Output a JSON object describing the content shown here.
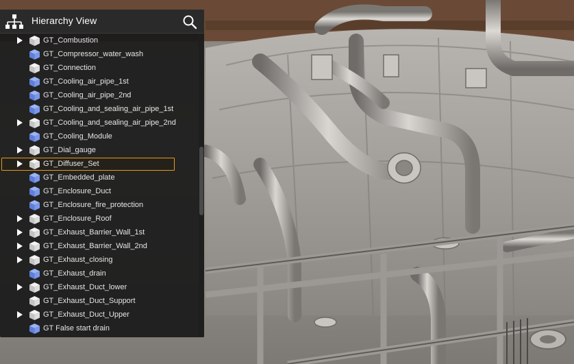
{
  "panel": {
    "title": "Hierarchy View",
    "header_icon": "hierarchy-icon",
    "search_icon": "search-icon"
  },
  "colors": {
    "selection": "#e59a19",
    "panel_bg": "#1a1a1a",
    "cube_blue": "#6f8fe6",
    "cube_gray": "#d6d6d6"
  },
  "items": [
    {
      "label": "GT_Combustion",
      "expandable": true,
      "cube": "gray",
      "selected": false
    },
    {
      "label": "GT_Compressor_water_wash",
      "expandable": false,
      "cube": "blue",
      "selected": false
    },
    {
      "label": "GT_Connection",
      "expandable": false,
      "cube": "gray",
      "selected": false
    },
    {
      "label": "GT_Cooling_air_pipe_1st",
      "expandable": false,
      "cube": "blue",
      "selected": false
    },
    {
      "label": "GT_Cooling_air_pipe_2nd",
      "expandable": false,
      "cube": "blue",
      "selected": false
    },
    {
      "label": "GT_Cooling_and_sealing_air_pipe_1st",
      "expandable": false,
      "cube": "blue",
      "selected": false
    },
    {
      "label": "GT_Cooling_and_sealing_air_pipe_2nd",
      "expandable": true,
      "cube": "gray",
      "selected": false
    },
    {
      "label": "GT_Cooling_Module",
      "expandable": false,
      "cube": "blue",
      "selected": false
    },
    {
      "label": "GT_Dial_gauge",
      "expandable": true,
      "cube": "gray",
      "selected": false
    },
    {
      "label": "GT_Diffuser_Set",
      "expandable": true,
      "cube": "gray",
      "selected": true
    },
    {
      "label": "GT_Embedded_plate",
      "expandable": false,
      "cube": "blue",
      "selected": false
    },
    {
      "label": "GT_Enclosure_Duct",
      "expandable": false,
      "cube": "blue",
      "selected": false
    },
    {
      "label": "GT_Enclosure_fire_protection",
      "expandable": false,
      "cube": "blue",
      "selected": false
    },
    {
      "label": "GT_Enclosure_Roof",
      "expandable": true,
      "cube": "gray",
      "selected": false
    },
    {
      "label": "GT_Exhaust_Barrier_Wall_1st",
      "expandable": true,
      "cube": "gray",
      "selected": false
    },
    {
      "label": "GT_Exhaust_Barrier_Wall_2nd",
      "expandable": true,
      "cube": "gray",
      "selected": false
    },
    {
      "label": "GT_Exhaust_closing",
      "expandable": true,
      "cube": "gray",
      "selected": false
    },
    {
      "label": "GT_Exhaust_drain",
      "expandable": false,
      "cube": "blue",
      "selected": false
    },
    {
      "label": "GT_Exhaust_Duct_lower",
      "expandable": true,
      "cube": "gray",
      "selected": false
    },
    {
      "label": "GT_Exhaust_Duct_Support",
      "expandable": false,
      "cube": "gray",
      "selected": false
    },
    {
      "label": "GT_Exhaust_Duct_Upper",
      "expandable": true,
      "cube": "gray",
      "selected": false
    },
    {
      "label": "GT False start drain",
      "expandable": false,
      "cube": "blue",
      "selected": false
    }
  ]
}
